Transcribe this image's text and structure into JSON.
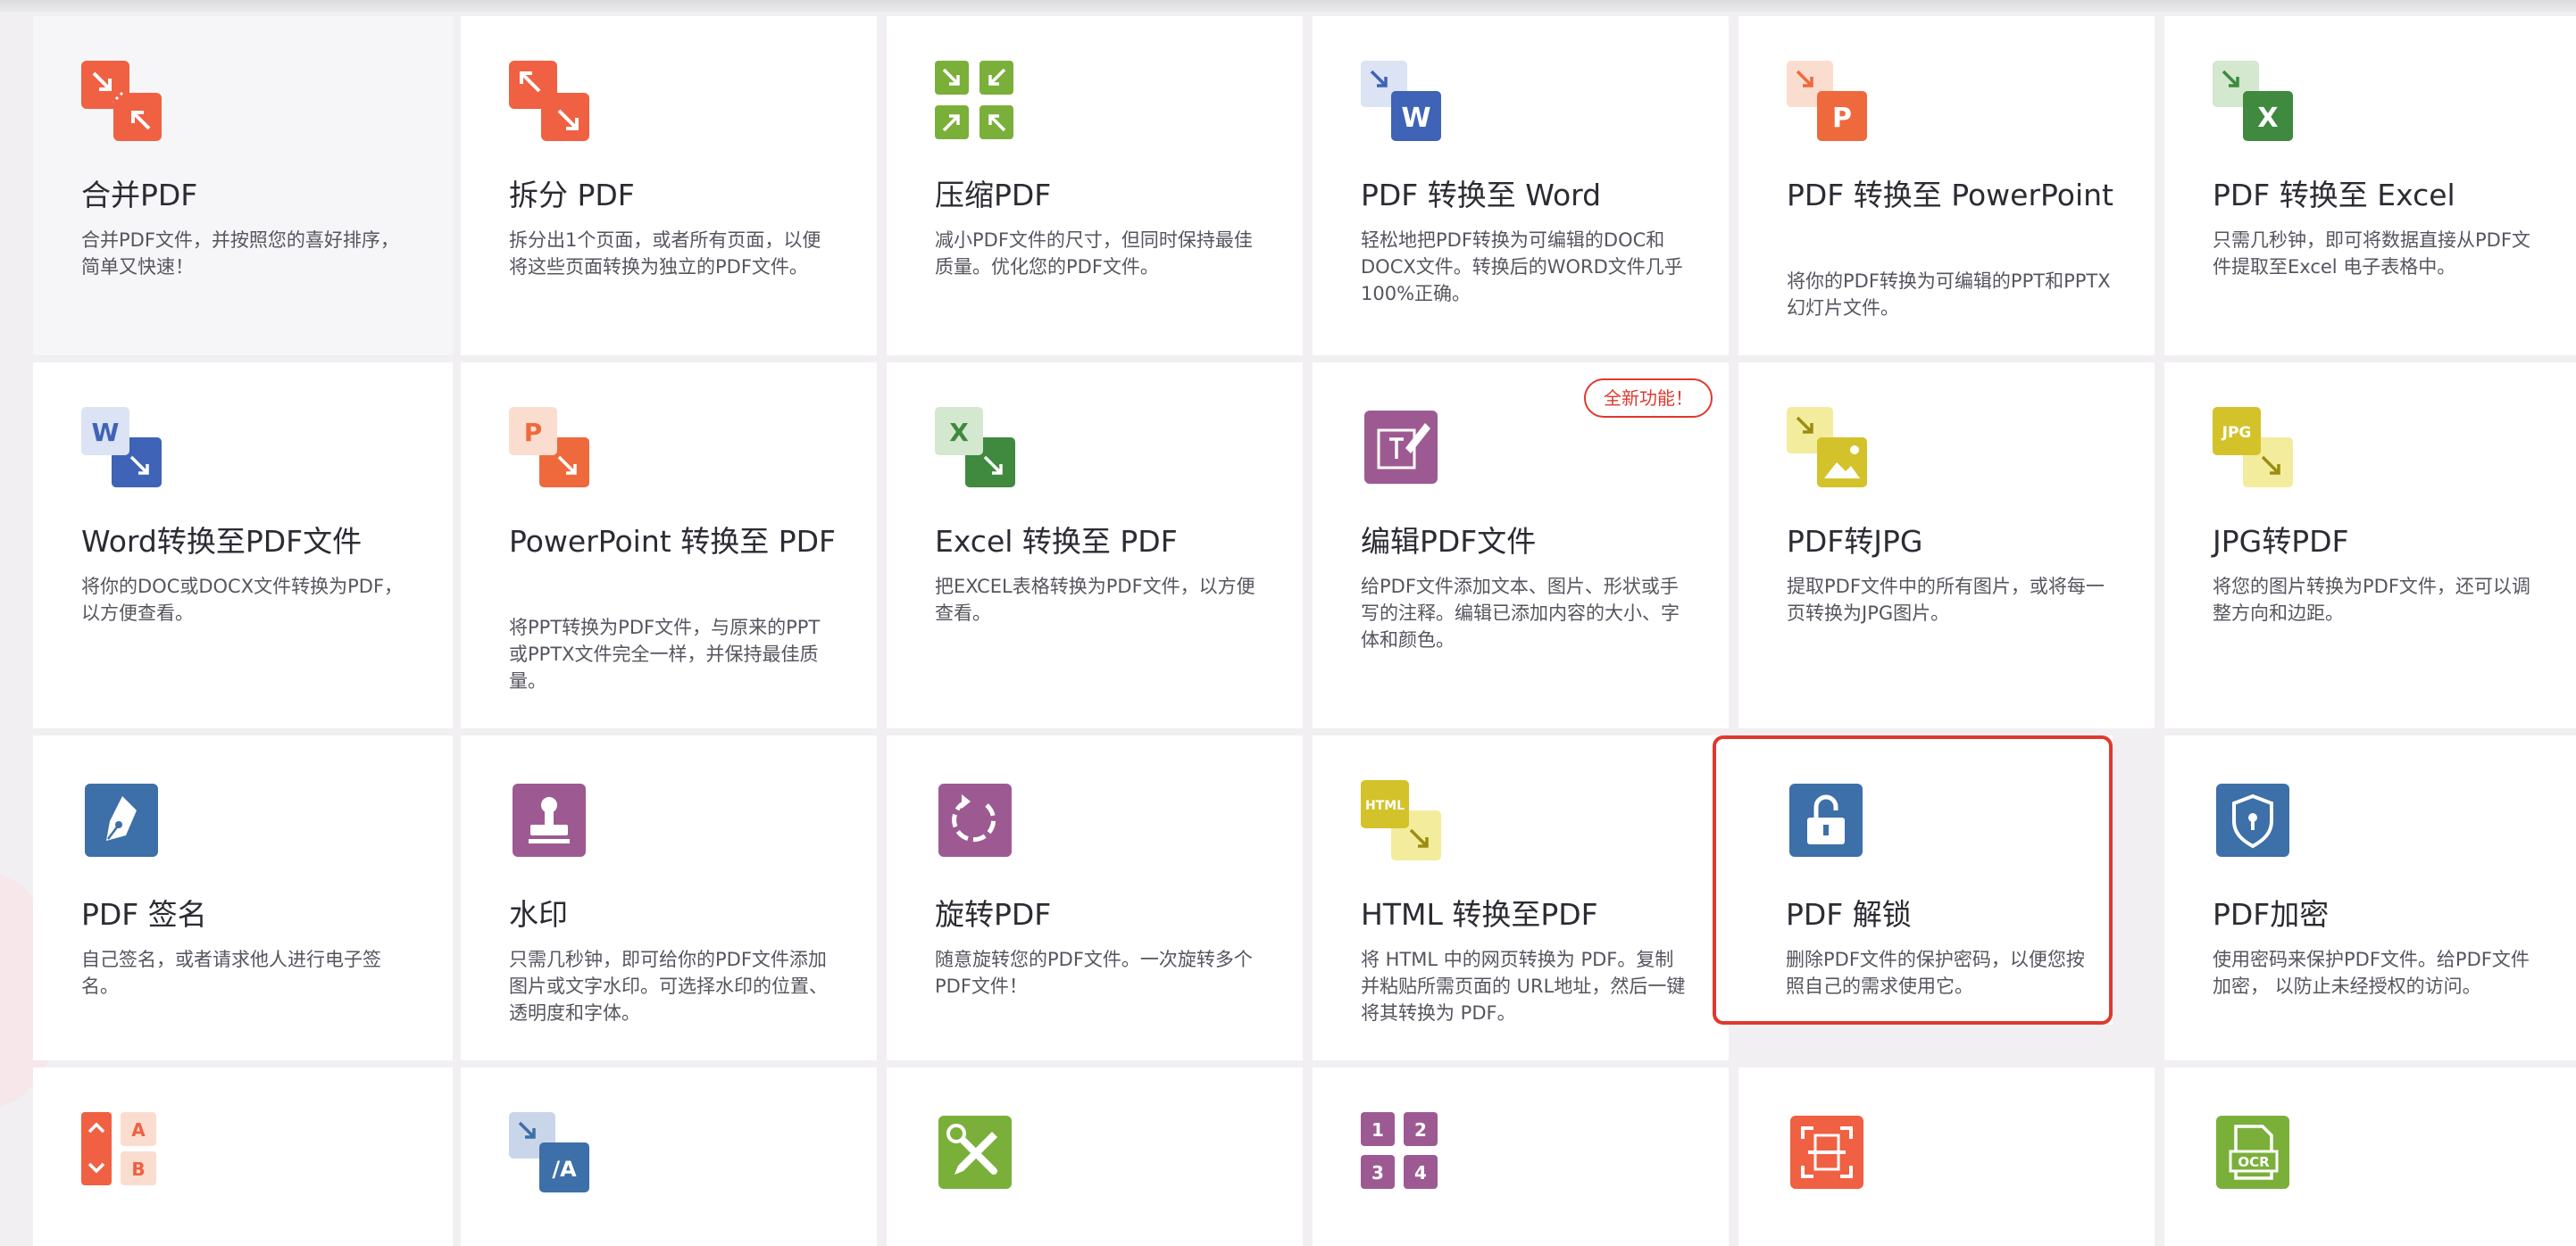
{
  "colors": {
    "red_orange": "#f06042",
    "word_blue": "#3f63b6",
    "excel_green": "#3f8a3e",
    "ppt_orange": "#ee6a3c",
    "yellow": "#d4c22b",
    "purple": "#9d5a92",
    "steel_blue": "#3d6fa8",
    "lime_green": "#7ab03a",
    "accent_red": "#e0382e"
  },
  "tools": [
    {
      "title": "合并PDF",
      "desc": "合并PDF文件，并按照您的喜好排序，简单又快速！",
      "icon": "merge-icon"
    },
    {
      "title": "拆分 PDF",
      "desc": "拆分出1个页面，或者所有页面，以便将这些页面转换为独立的PDF文件。",
      "icon": "split-icon"
    },
    {
      "title": "压缩PDF",
      "desc": "减小PDF文件的尺寸，但同时保持最佳质量。优化您的PDF文件。",
      "icon": "compress-icon"
    },
    {
      "title": "PDF 转换至 Word",
      "desc": "轻松地把PDF转换为可编辑的DOC和DOCX文件。转换后的WORD文件几乎100%正确。",
      "icon": "pdf-to-word-icon"
    },
    {
      "title": "PDF 转换至 PowerPoint",
      "desc": "将你的PDF转换为可编辑的PPT和PPTX幻灯片文件。",
      "icon": "pdf-to-powerpoint-icon"
    },
    {
      "title": "PDF 转换至 Excel",
      "desc": "只需几秒钟，即可将数据直接从PDF文件提取至Excel 电子表格中。",
      "icon": "pdf-to-excel-icon"
    },
    {
      "title": "Word转换至PDF文件",
      "desc": "将你的DOC或DOCX文件转换为PDF，以方便查看。",
      "icon": "word-to-pdf-icon"
    },
    {
      "title": "PowerPoint 转换至 PDF",
      "desc": "将PPT转换为PDF文件，与原来的PPT或PPTX文件完全一样，并保持最佳质量。",
      "icon": "powerpoint-to-pdf-icon"
    },
    {
      "title": "Excel 转换至 PDF",
      "desc": "把EXCEL表格转换为PDF文件，以方便查看。",
      "icon": "excel-to-pdf-icon"
    },
    {
      "title": "编辑PDF文件",
      "desc": "给PDF文件添加文本、图片、形状或手写的注释。编辑已添加内容的大小、字体和颜色。",
      "icon": "edit-pdf-icon",
      "badge": "全新功能！"
    },
    {
      "title": "PDF转JPG",
      "desc": "提取PDF文件中的所有图片，或将每一页转换为JPG图片。",
      "icon": "pdf-to-jpg-icon"
    },
    {
      "title": "JPG转PDF",
      "desc": "将您的图片转换为PDF文件，还可以调整方向和边距。",
      "icon": "jpg-to-pdf-icon"
    },
    {
      "title": "PDF 签名",
      "desc": "自己签名，或者请求他人进行电子签名。",
      "icon": "sign-pen-icon"
    },
    {
      "title": "水印",
      "desc": "只需几秒钟，即可给你的PDF文件添加图片或文字水印。可选择水印的位置、透明度和字体。",
      "icon": "watermark-stamp-icon"
    },
    {
      "title": "旋转PDF",
      "desc": "随意旋转您的PDF文件。一次旋转多个PDF文件！",
      "icon": "rotate-icon"
    },
    {
      "title": "HTML 转换至PDF",
      "desc": "将 HTML 中的网页转换为 PDF。复制并粘贴所需页面的 URL地址，然后一键将其转换为 PDF。",
      "icon": "html-to-pdf-icon"
    },
    {
      "title": "PDF 解锁",
      "desc": "删除PDF文件的保护密码，以便您按照自己的需求使用它。",
      "icon": "unlock-icon",
      "highlight": true
    },
    {
      "title": "PDF加密",
      "desc": "使用密码来保护PDF文件。给PDF文件加密， 以防止未经授权的访问。",
      "icon": "protect-shield-icon"
    },
    {
      "title": "",
      "desc": "",
      "icon": "organize-pages-icon"
    },
    {
      "title": "",
      "desc": "",
      "icon": "pdfa-icon"
    },
    {
      "title": "",
      "desc": "",
      "icon": "repair-tools-icon"
    },
    {
      "title": "",
      "desc": "",
      "icon": "page-numbers-icon"
    },
    {
      "title": "",
      "desc": "",
      "icon": "scan-icon"
    },
    {
      "title": "",
      "desc": "",
      "icon": "ocr-icon"
    }
  ],
  "icon_labels": {
    "word": "W",
    "powerpoint": "P",
    "excel": "X",
    "jpg": "JPG",
    "html": "HTML",
    "pdfa": "/A",
    "organize_a": "A",
    "organize_b": "B",
    "numbers": [
      "1",
      "2",
      "3",
      "4"
    ],
    "ocr": "OCR"
  }
}
